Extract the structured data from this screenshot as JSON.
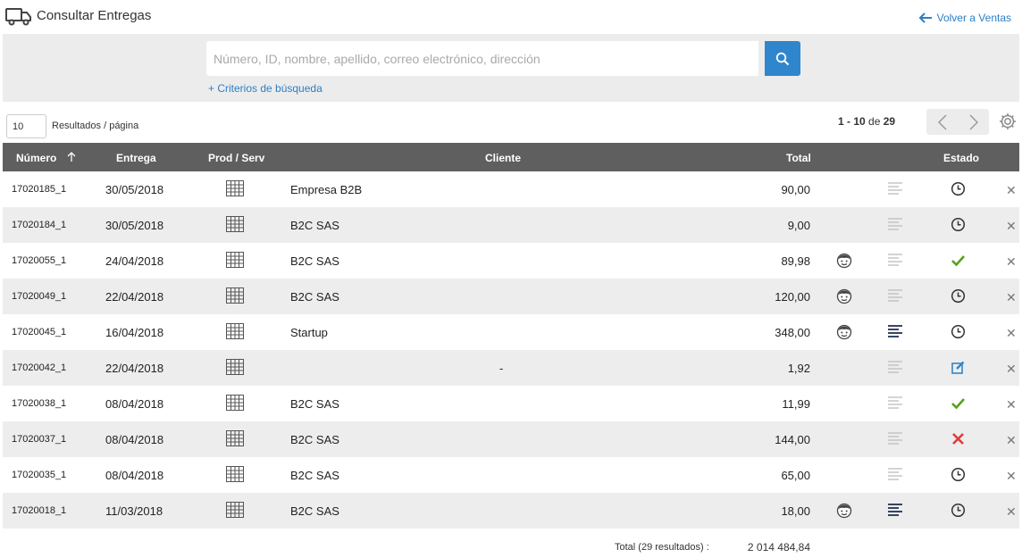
{
  "header": {
    "title": "Consultar Entregas",
    "back_label": "Volver a Ventas"
  },
  "search": {
    "placeholder": "Número, ID, nombre, apellido, correo electrónico, dirección",
    "criteria_label": "+ Criterios de búsqueda"
  },
  "pagination": {
    "per_page_value": "10",
    "per_page_label": "Resultados / página",
    "range": "1 - 10",
    "of_label": "de",
    "total": "29"
  },
  "table": {
    "columns": {
      "number": "Número",
      "delivery": "Entrega",
      "prod": "Prod / Serv",
      "client": "Cliente",
      "total": "Total",
      "status": "Estado"
    },
    "rows": [
      {
        "number": "17020185_1",
        "date": "30/05/2018",
        "client": "Empresa B2B",
        "total": "90,00",
        "face": false,
        "lines": "light",
        "status": "pending"
      },
      {
        "number": "17020184_1",
        "date": "30/05/2018",
        "client": "B2C SAS",
        "total": "9,00",
        "face": false,
        "lines": "light",
        "status": "pending"
      },
      {
        "number": "17020055_1",
        "date": "24/04/2018",
        "client": "B2C SAS",
        "total": "89,98",
        "face": true,
        "lines": "light",
        "status": "done"
      },
      {
        "number": "17020049_1",
        "date": "22/04/2018",
        "client": "B2C SAS",
        "total": "120,00",
        "face": true,
        "lines": "light",
        "status": "pending"
      },
      {
        "number": "17020045_1",
        "date": "16/04/2018",
        "client": "Startup",
        "total": "348,00",
        "face": true,
        "lines": "dark",
        "status": "pending"
      },
      {
        "number": "17020042_1",
        "date": "22/04/2018",
        "client": "-",
        "total": "1,92",
        "face": false,
        "lines": "light",
        "status": "edit"
      },
      {
        "number": "17020038_1",
        "date": "08/04/2018",
        "client": "B2C SAS",
        "total": "11,99",
        "face": false,
        "lines": "light",
        "status": "done"
      },
      {
        "number": "17020037_1",
        "date": "08/04/2018",
        "client": "B2C SAS",
        "total": "144,00",
        "face": false,
        "lines": "light",
        "status": "cancelled"
      },
      {
        "number": "17020035_1",
        "date": "08/04/2018",
        "client": "B2C SAS",
        "total": "65,00",
        "face": false,
        "lines": "light",
        "status": "pending"
      },
      {
        "number": "17020018_1",
        "date": "11/03/2018",
        "client": "B2C SAS",
        "total": "18,00",
        "face": true,
        "lines": "dark",
        "status": "pending"
      }
    ]
  },
  "footer": {
    "total_label": "Total (29 resultados) :",
    "total_value": "2 014 484,84"
  },
  "colors": {
    "accent": "#2f86cc",
    "header_bg": "#5f5f5f",
    "success": "#5a9e1e",
    "danger": "#e03a3a"
  },
  "icons": {
    "title": "truck-icon",
    "back": "arrow-left-icon",
    "search": "search-icon",
    "prev": "chevron-left-icon",
    "next": "chevron-right-icon",
    "settings": "gear-icon",
    "sort": "arrow-up-icon",
    "product": "grid-icon",
    "customer": "face-icon",
    "notes": "lines-icon",
    "pending": "clock-icon",
    "done": "check-icon",
    "cancelled": "x-icon",
    "edit": "edit-icon",
    "delete": "close-icon"
  }
}
